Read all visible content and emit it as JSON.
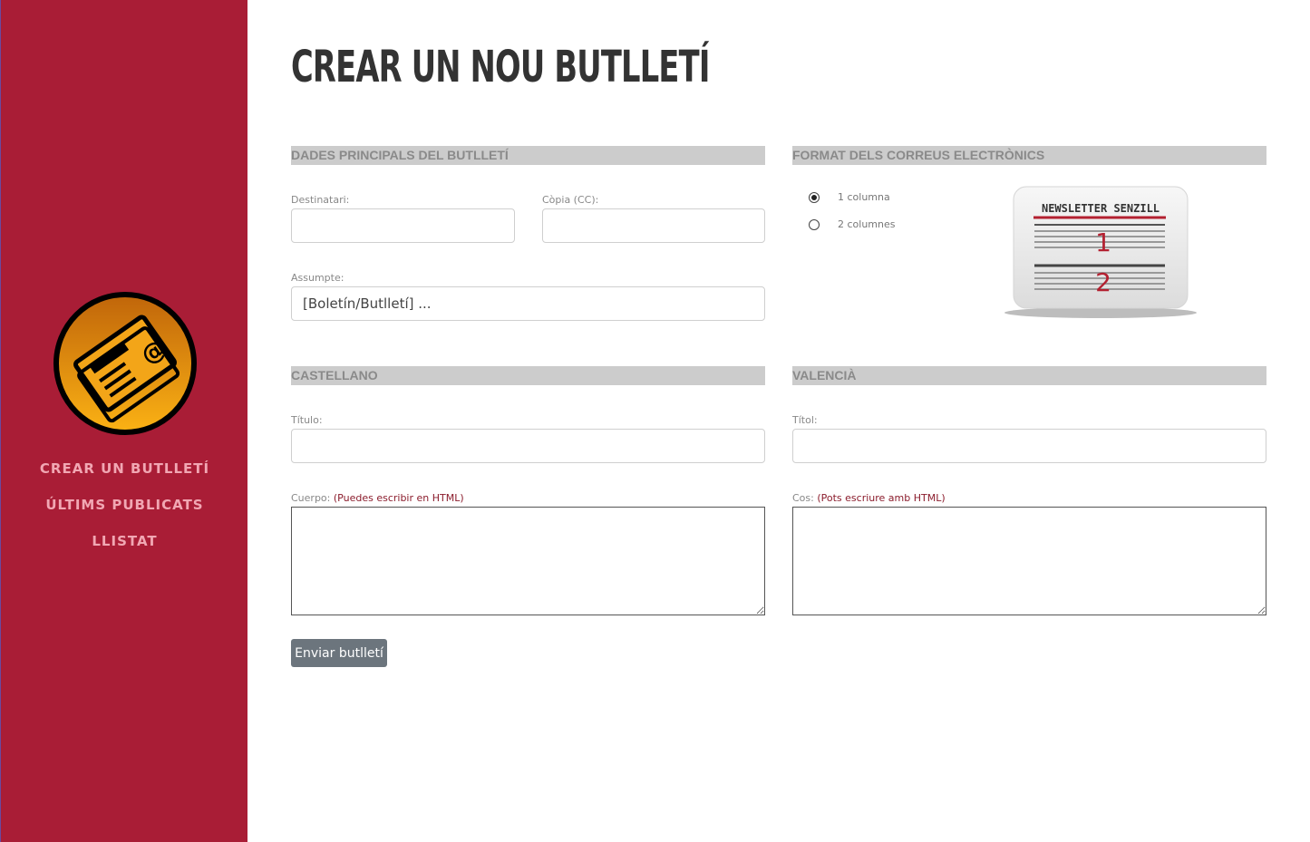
{
  "sidebar": {
    "logo_icon": "newsletter-at-icon",
    "nav": [
      {
        "label": "CREAR UN BUTLLETÍ"
      },
      {
        "label": "ÚLTIMS PUBLICATS"
      },
      {
        "label": "LLISTAT"
      }
    ],
    "colors": {
      "background": "#a91d36",
      "nav_text": "#f1a7b3"
    }
  },
  "page": {
    "title": "CREAR UN NOU BUTLLETÍ"
  },
  "main_data": {
    "heading": "DADES PRINCIPALS DEL BUTLLETÍ",
    "recipient": {
      "label": "Destinatari:",
      "value": ""
    },
    "cc": {
      "label": "Còpia (CC):",
      "value": ""
    },
    "subject": {
      "label": "Assumpte:",
      "value": "[Boletín/Butlletí] ..."
    }
  },
  "format": {
    "heading": "FORMAT DELS CORREUS ELECTRÒNICS",
    "options": [
      {
        "label": "1 columna",
        "checked": true
      },
      {
        "label": "2 columnes",
        "checked": false
      }
    ],
    "preview": {
      "header": "NEWSLETTER SENZILL",
      "item1": "1",
      "item2": "2"
    }
  },
  "castellano": {
    "heading": "CASTELLANO",
    "title_label": "Título:",
    "body_label": "Cuerpo:",
    "body_hint": "(Puedes escribir en HTML)"
  },
  "valencia": {
    "heading": "VALENCIÀ",
    "title_label": "Títol:",
    "body_label": "Cos:",
    "body_hint": "(Pots escriure amb HTML)"
  },
  "submit": {
    "label": "Enviar butlletí"
  }
}
